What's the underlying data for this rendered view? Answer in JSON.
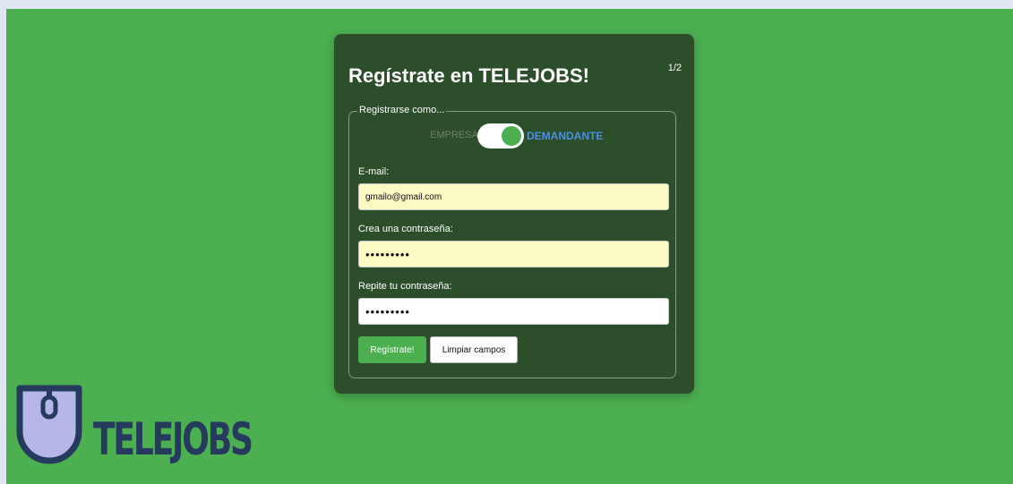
{
  "card": {
    "title": "Regístrate en TELEJOBS!",
    "step": "1/2"
  },
  "fieldset": {
    "legend": "Registrarse como..."
  },
  "toggle": {
    "left_option": "EMPRESA",
    "right_option": "DEMANDANTE",
    "selected": "DEMANDANTE"
  },
  "form": {
    "email_label": "E-mail:",
    "email_value": "gmailo@gmail.com",
    "password_label": "Crea una contraseña:",
    "password_value": "•••••••••",
    "repeat_label": "Repite tu contraseña:",
    "repeat_value": "•••••••••"
  },
  "buttons": {
    "submit": "Regístrate!",
    "clear": "Limpiar campos"
  },
  "logo": {
    "text": "TELEJOBS",
    "icon": "computer-mouse-icon"
  },
  "colors": {
    "page_background": "#4caf50",
    "card_background": "#2d4e2b",
    "accent_blue": "#4a90e2",
    "autofill_yellow": "#fcfac3",
    "logo_navy": "#253a5c",
    "logo_lavender": "#b7b6e8"
  }
}
